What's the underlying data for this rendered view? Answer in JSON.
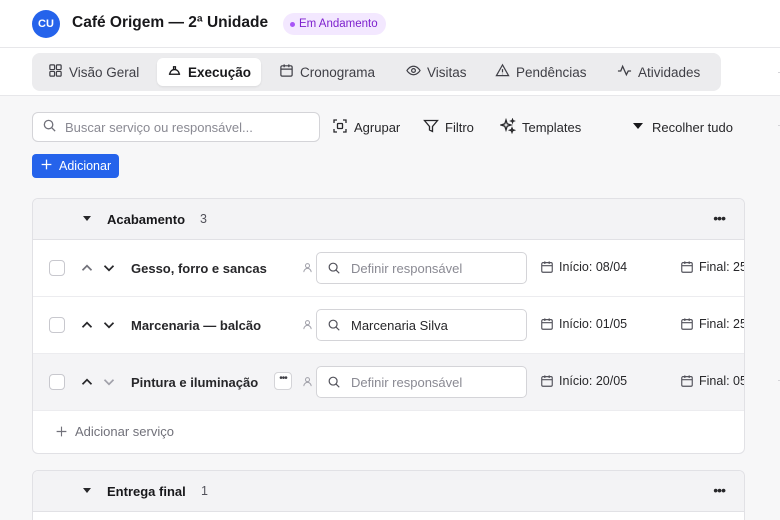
{
  "header": {
    "avatar_initials": "CU",
    "title": "Café Origem — 2ª Unidade",
    "status": "Em Andamento"
  },
  "tabs": [
    {
      "label": "Visão Geral",
      "icon": "grid-icon"
    },
    {
      "label": "Execução",
      "icon": "hard-hat-icon",
      "active": true
    },
    {
      "label": "Cronograma",
      "icon": "calendar-icon"
    },
    {
      "label": "Visitas",
      "icon": "eye-icon"
    },
    {
      "label": "Pendências",
      "icon": "warning-icon"
    },
    {
      "label": "Atividades",
      "icon": "activity-icon"
    }
  ],
  "toolbar": {
    "search_placeholder": "Buscar serviço ou responsável...",
    "group_label": "Agrupar",
    "filter_label": "Filtro",
    "templates_label": "Templates",
    "collapse_label": "Recolher tudo",
    "add_label": "Adicionar"
  },
  "groups": [
    {
      "name": "Acabamento",
      "count": "3",
      "items": [
        {
          "name": "Gesso, forro e sancas",
          "responsible": "",
          "responsible_placeholder": "Definir responsável",
          "start": "Início: 08/04",
          "end": "Final: 25"
        },
        {
          "name": "Marcenaria — balcão",
          "responsible": "Marcenaria Silva",
          "responsible_placeholder": "Definir responsável",
          "start": "Início: 01/05",
          "end": "Final: 25"
        },
        {
          "name": "Pintura e iluminação",
          "responsible": "",
          "responsible_placeholder": "Definir responsável",
          "start": "Início: 20/05",
          "end": "Final: 05"
        }
      ],
      "add_service_label": "Adicionar serviço"
    },
    {
      "name": "Entrega final",
      "count": "1"
    }
  ],
  "colors": {
    "accent": "#2563eb",
    "status_bg": "#f3e8ff",
    "status_fg": "#7e22ce"
  }
}
